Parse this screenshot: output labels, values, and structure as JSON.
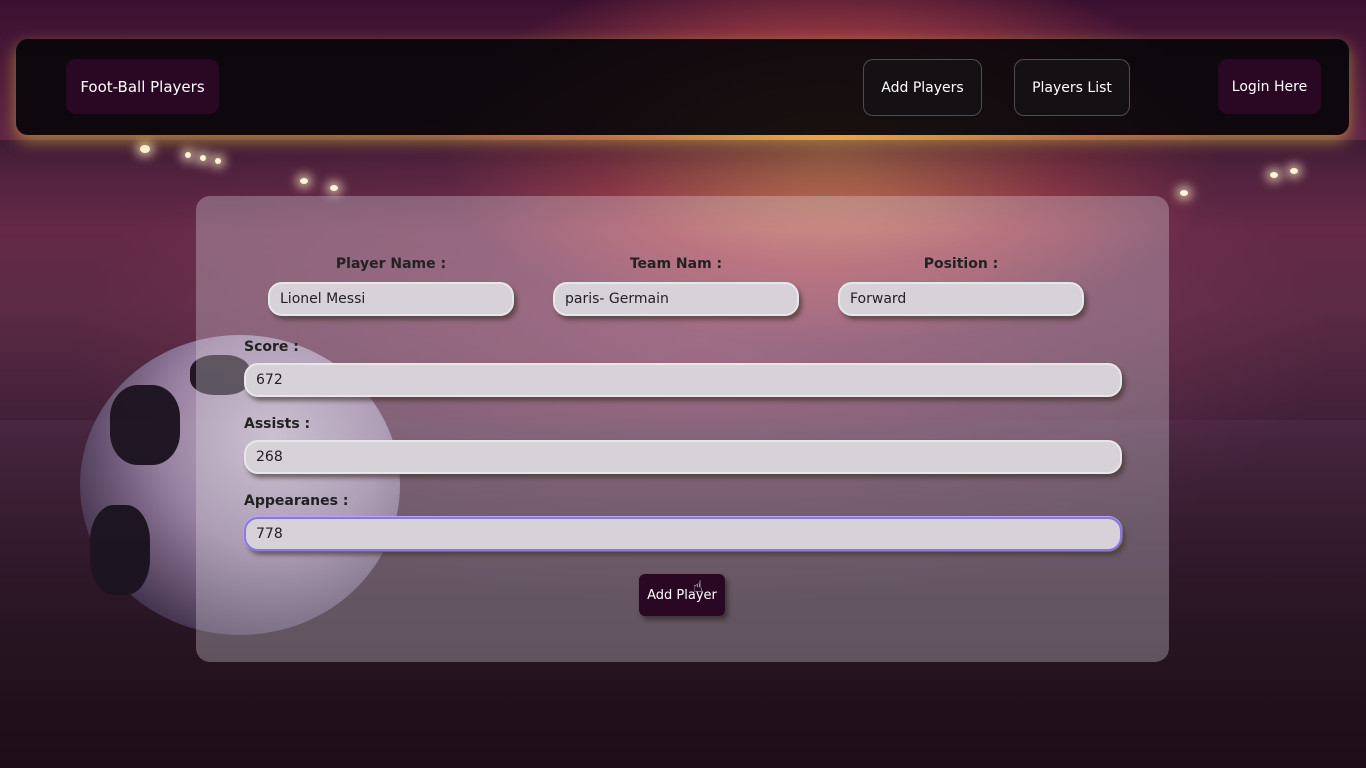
{
  "navbar": {
    "brand": "Foot-Ball Players",
    "add_players": "Add Players",
    "players_list": "Players List",
    "login": "Login Here"
  },
  "form": {
    "player_name": {
      "label": "Player Name :",
      "value": "Lionel Messi"
    },
    "team_name": {
      "label": "Team Nam :",
      "value": "paris- Germain"
    },
    "position": {
      "label": "Position :",
      "value": "Forward"
    },
    "score": {
      "label": "Score :",
      "value": "672"
    },
    "assists": {
      "label": "Assists :",
      "value": "268"
    },
    "appearances": {
      "label": "Appearanes :",
      "value": "778"
    },
    "submit": "Add Player"
  },
  "cursor": "hand-pointer-icon"
}
